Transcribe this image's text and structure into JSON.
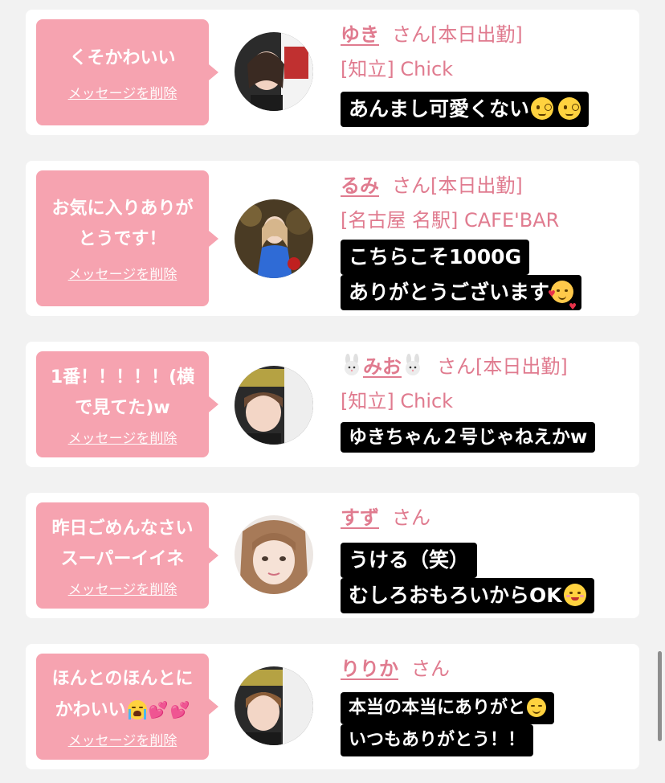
{
  "delete_label": "メッセージを削除",
  "name_suffix": "さん",
  "cards": [
    {
      "message": "くそかわいい",
      "name": "ゆき",
      "status": "[本日出勤]",
      "shop": "[知立] Chick",
      "reply": [
        "あんまし可愛くない"
      ]
    },
    {
      "message": "お気に入りありがとうです！",
      "name": "るみ",
      "status": "[本日出勤]",
      "shop": "[名古屋 名駅] CAFE'BAR",
      "reply": [
        "こちらこそ1000G",
        "ありがとうございます"
      ]
    },
    {
      "message": "1番！！！！！(横で見てた)w",
      "name": "みお",
      "status": "[本日出勤]",
      "shop": "[知立] Chick",
      "reply": [
        "ゆきちゃん２号じゃねえかw"
      ]
    },
    {
      "message": "昨日ごめんなさいスーパーイイネ",
      "name": "すず",
      "status": "",
      "shop": "",
      "reply": [
        "うける（笑）",
        "むしろおもろいからOK"
      ]
    },
    {
      "message": "ほんとのほんとにかわいい",
      "name": "りりか",
      "status": "",
      "shop": "",
      "reply": [
        "本当の本当にありがと",
        "いつもありがとう！！"
      ]
    }
  ]
}
